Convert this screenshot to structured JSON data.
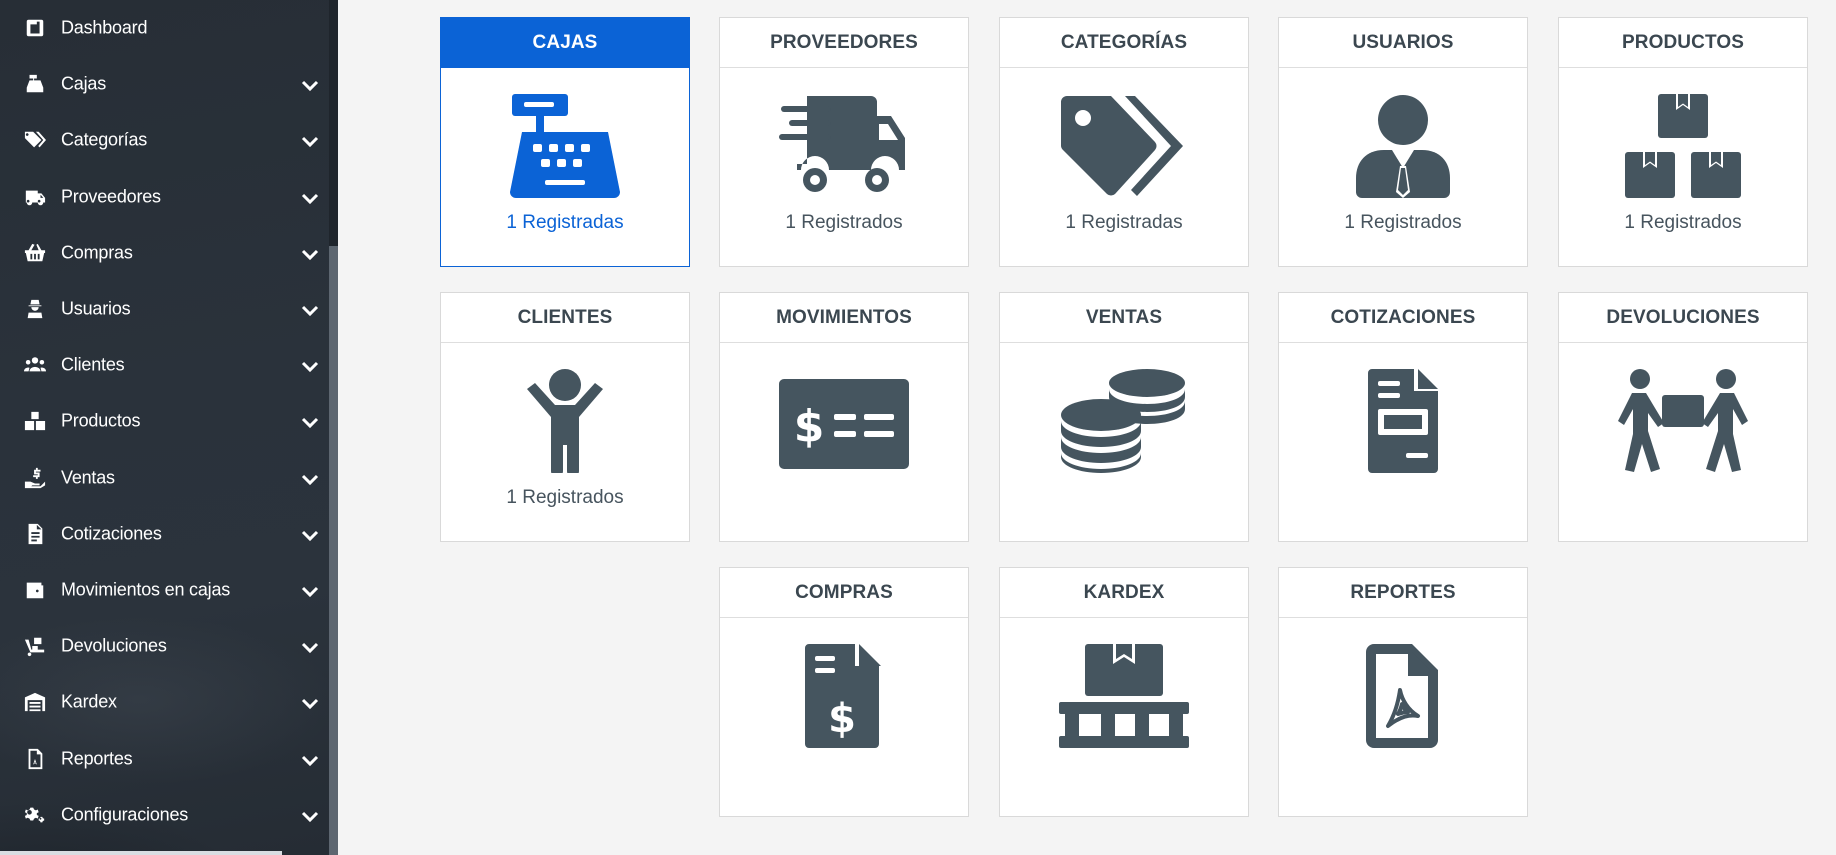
{
  "sidebar": {
    "items": [
      {
        "label": "Dashboard",
        "icon": "dashboard-icon",
        "chevron": false
      },
      {
        "label": "Cajas",
        "icon": "cash-register-icon",
        "chevron": true
      },
      {
        "label": "Categorías",
        "icon": "tags-icon",
        "chevron": true
      },
      {
        "label": "Proveedores",
        "icon": "truck-icon",
        "chevron": true
      },
      {
        "label": "Compras",
        "icon": "basket-icon",
        "chevron": true
      },
      {
        "label": "Usuarios",
        "icon": "user-secret-icon",
        "chevron": true
      },
      {
        "label": "Clientes",
        "icon": "users-icon",
        "chevron": true
      },
      {
        "label": "Productos",
        "icon": "boxes-icon",
        "chevron": true
      },
      {
        "label": "Ventas",
        "icon": "hand-dollar-icon",
        "chevron": true
      },
      {
        "label": "Cotizaciones",
        "icon": "file-icon",
        "chevron": true
      },
      {
        "label": "Movimientos en cajas",
        "icon": "wallet-icon",
        "chevron": true
      },
      {
        "label": "Devoluciones",
        "icon": "dolly-icon",
        "chevron": true
      },
      {
        "label": "Kardex",
        "icon": "warehouse-icon",
        "chevron": true
      },
      {
        "label": "Reportes",
        "icon": "file-pdf-icon",
        "chevron": true
      },
      {
        "label": "Configuraciones",
        "icon": "cogs-icon",
        "chevron": true
      }
    ]
  },
  "cards": [
    {
      "title": "CAJAS",
      "icon": "cash-register-icon",
      "count": "1 Registradas",
      "active": true
    },
    {
      "title": "PROVEEDORES",
      "icon": "truck-fast-icon",
      "count": "1 Registrados"
    },
    {
      "title": "CATEGORÍAS",
      "icon": "tags-icon",
      "count": "1 Registradas"
    },
    {
      "title": "USUARIOS",
      "icon": "user-tie-icon",
      "count": "1 Registrados"
    },
    {
      "title": "PRODUCTOS",
      "icon": "boxes-icon",
      "count": "1 Registrados"
    },
    {
      "title": "CLIENTES",
      "icon": "child-icon",
      "count": "1 Registrados"
    },
    {
      "title": "MOVIMIENTOS",
      "icon": "money-check-icon",
      "count": ""
    },
    {
      "title": "VENTAS",
      "icon": "coins-icon",
      "count": ""
    },
    {
      "title": "COTIZACIONES",
      "icon": "file-invoice-icon",
      "count": ""
    },
    {
      "title": "DEVOLUCIONES",
      "icon": "people-carry-icon",
      "count": ""
    },
    {
      "title": "COMPRAS",
      "icon": "file-invoice-dollar-icon",
      "count": ""
    },
    {
      "title": "KARDEX",
      "icon": "pallet-icon",
      "count": ""
    },
    {
      "title": "REPORTES",
      "icon": "file-pdf-icon",
      "count": ""
    }
  ],
  "colors": {
    "sidebar_bg": "#2a323b",
    "accent": "#0b63d6",
    "icon_gray": "#45555f",
    "text_gray": "#47545e",
    "page_bg": "#f4f4f4"
  }
}
